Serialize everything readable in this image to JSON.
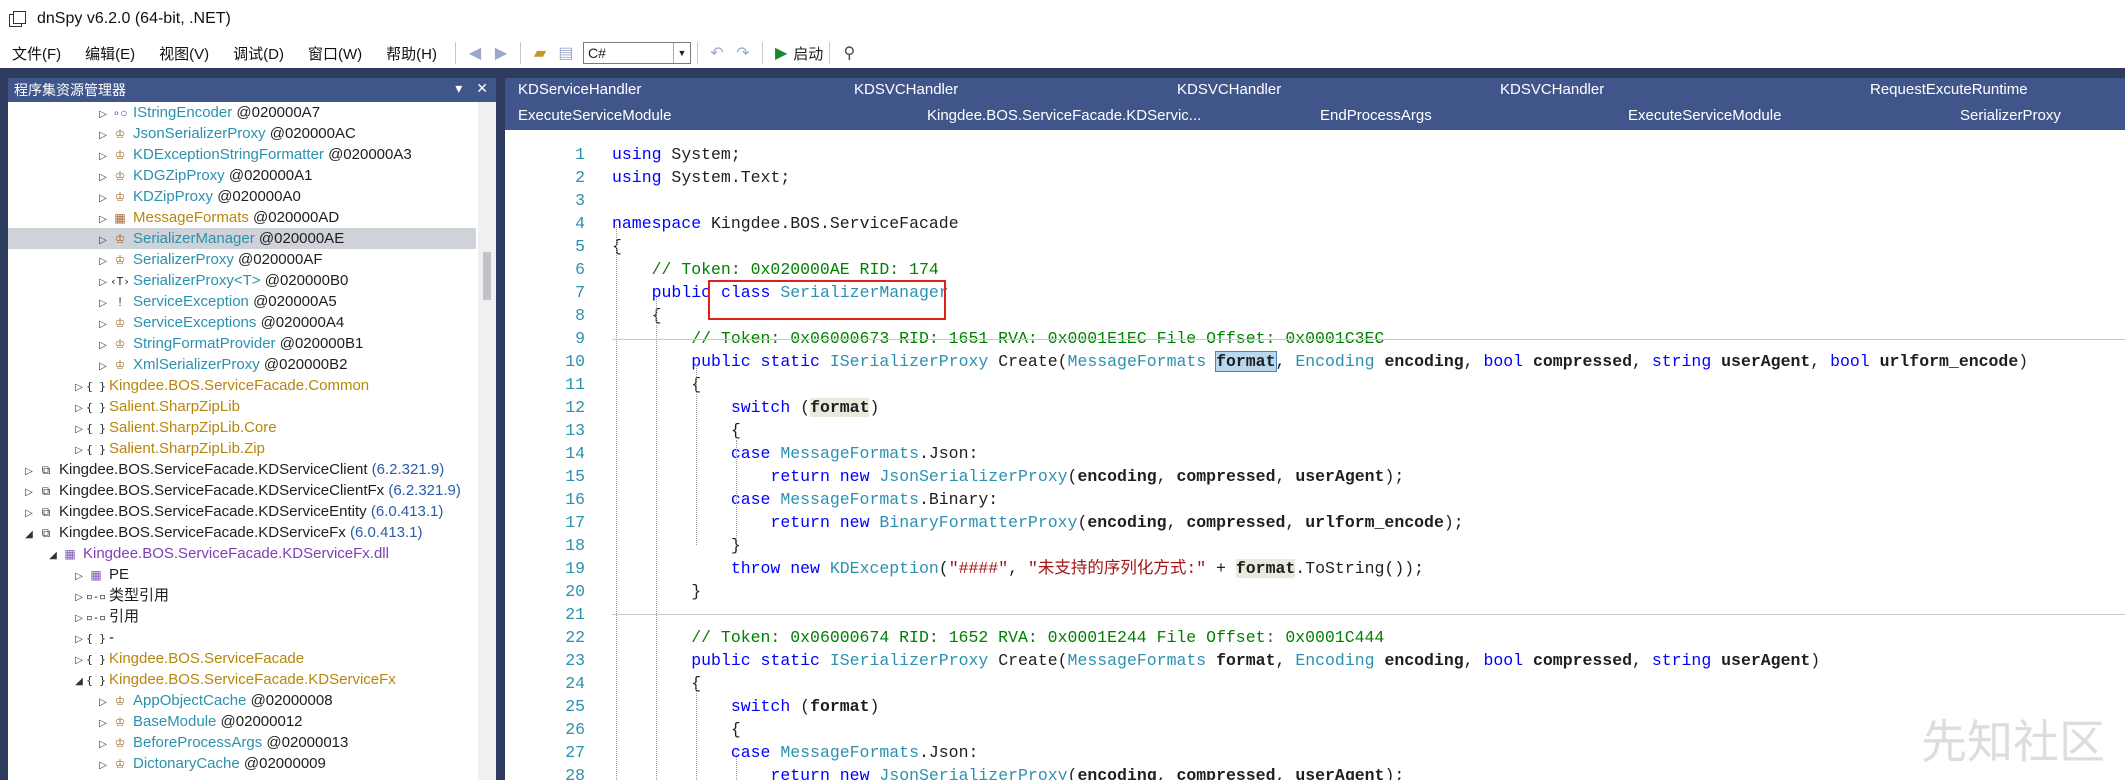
{
  "window": {
    "title": "dnSpy v6.2.0 (64-bit, .NET)"
  },
  "menu": [
    "文件(F)",
    "编辑(E)",
    "视图(V)",
    "调试(D)",
    "窗口(W)",
    "帮助(H)"
  ],
  "toolbar": {
    "language": "C#",
    "run_label": "启动"
  },
  "explorer": {
    "title": "程序集资源管理器",
    "rows": [
      {
        "indent": 88,
        "arrow": "▷",
        "icon": "∘○",
        "iconClass": "iface",
        "name": "IStringEncoder",
        "token": " @020000A7",
        "nameClass": "c-type"
      },
      {
        "indent": 88,
        "arrow": "▷",
        "icon": "♔",
        "iconClass": "cls",
        "name": "JsonSerializerProxy",
        "token": " @020000AC",
        "nameClass": "c-type"
      },
      {
        "indent": 88,
        "arrow": "▷",
        "icon": "♔",
        "iconClass": "cls",
        "name": "KDExceptionStringFormatter",
        "token": " @020000A3",
        "nameClass": "c-type"
      },
      {
        "indent": 88,
        "arrow": "▷",
        "icon": "♔",
        "iconClass": "cls",
        "name": "KDGZipProxy",
        "token": " @020000A1",
        "nameClass": "c-type"
      },
      {
        "indent": 88,
        "arrow": "▷",
        "icon": "♔",
        "iconClass": "cls",
        "name": "KDZipProxy",
        "token": " @020000A0",
        "nameClass": "c-type"
      },
      {
        "indent": 88,
        "arrow": "▷",
        "icon": "▦",
        "iconClass": "cls",
        "name": "MessageFormats",
        "token": " @020000AD",
        "nameClass": "c-ns"
      },
      {
        "indent": 88,
        "arrow": "▷",
        "icon": "♔",
        "iconClass": "cls",
        "name": "SerializerManager",
        "token": " @020000AE",
        "nameClass": "c-type",
        "selected": true
      },
      {
        "indent": 88,
        "arrow": "▷",
        "icon": "♔",
        "iconClass": "cls",
        "name": "SerializerProxy",
        "token": " @020000AF",
        "nameClass": "c-type"
      },
      {
        "indent": 88,
        "arrow": "▷",
        "icon": "‹T›",
        "iconClass": "ns",
        "name": "SerializerProxy<T>",
        "token": " @020000B0",
        "nameClass": "c-type"
      },
      {
        "indent": 88,
        "arrow": "▷",
        "icon": "!",
        "iconClass": "asm",
        "name": "ServiceException",
        "token": " @020000A5",
        "nameClass": "c-type"
      },
      {
        "indent": 88,
        "arrow": "▷",
        "icon": "♔",
        "iconClass": "cls",
        "name": "ServiceExceptions",
        "token": " @020000A4",
        "nameClass": "c-type"
      },
      {
        "indent": 88,
        "arrow": "▷",
        "icon": "♔",
        "iconClass": "cls",
        "name": "StringFormatProvider",
        "token": " @020000B1",
        "nameClass": "c-type"
      },
      {
        "indent": 88,
        "arrow": "▷",
        "icon": "♔",
        "iconClass": "cls",
        "name": "XmlSerializerProxy",
        "token": " @020000B2",
        "nameClass": "c-type"
      },
      {
        "indent": 64,
        "arrow": "▷",
        "icon": "{ }",
        "iconClass": "ns",
        "name": "Kingdee.BOS.ServiceFacade.Common",
        "token": "",
        "nameClass": "c-ns"
      },
      {
        "indent": 64,
        "arrow": "▷",
        "icon": "{ }",
        "iconClass": "ns",
        "name": "Salient.SharpZipLib",
        "token": "",
        "nameClass": "c-ns"
      },
      {
        "indent": 64,
        "arrow": "▷",
        "icon": "{ }",
        "iconClass": "ns",
        "name": "Salient.SharpZipLib.Core",
        "token": "",
        "nameClass": "c-ns"
      },
      {
        "indent": 64,
        "arrow": "▷",
        "icon": "{ }",
        "iconClass": "ns",
        "name": "Salient.SharpZipLib.Zip",
        "token": "",
        "nameClass": "c-ns"
      },
      {
        "indent": 14,
        "arrow": "▷",
        "icon": "⧉",
        "iconClass": "asm",
        "name": "Kingdee.BOS.ServiceFacade.KDServiceClient",
        "token": " (6.2.321.9)",
        "nameClass": "c-plain",
        "tokenClass": "c-ver"
      },
      {
        "indent": 14,
        "arrow": "▷",
        "icon": "⧉",
        "iconClass": "asm",
        "name": "Kingdee.BOS.ServiceFacade.KDServiceClientFx",
        "token": " (6.2.321.9)",
        "nameClass": "c-plain",
        "tokenClass": "c-ver"
      },
      {
        "indent": 14,
        "arrow": "▷",
        "icon": "⧉",
        "iconClass": "asm",
        "name": "Kingdee.BOS.ServiceFacade.KDServiceEntity",
        "token": " (6.0.413.1)",
        "nameClass": "c-plain",
        "tokenClass": "c-ver"
      },
      {
        "indent": 14,
        "arrow": "◢",
        "icon": "⧉",
        "iconClass": "asm",
        "name": "Kingdee.BOS.ServiceFacade.KDServiceFx",
        "token": " (6.0.413.1)",
        "nameClass": "c-plain",
        "tokenClass": "c-ver"
      },
      {
        "indent": 38,
        "arrow": "◢",
        "icon": "▦",
        "iconClass": "dll",
        "name": "Kingdee.BOS.ServiceFacade.KDServiceFx.dll",
        "token": "",
        "nameClass": "c-dll"
      },
      {
        "indent": 64,
        "arrow": "▷",
        "icon": "▦",
        "iconClass": "dll",
        "name": "PE",
        "token": "",
        "nameClass": "c-plain"
      },
      {
        "indent": 64,
        "arrow": "▷",
        "icon": "▫-▫",
        "iconClass": "ns",
        "name": "类型引用",
        "token": "",
        "nameClass": "c-plain"
      },
      {
        "indent": 64,
        "arrow": "▷",
        "icon": "▫-▫",
        "iconClass": "ns",
        "name": "引用",
        "token": "",
        "nameClass": "c-plain"
      },
      {
        "indent": 64,
        "arrow": "▷",
        "icon": "{ }",
        "iconClass": "ns",
        "name": "-",
        "token": "",
        "nameClass": "c-plain"
      },
      {
        "indent": 64,
        "arrow": "▷",
        "icon": "{ }",
        "iconClass": "ns",
        "name": "Kingdee.BOS.ServiceFacade",
        "token": "",
        "nameClass": "c-ns"
      },
      {
        "indent": 64,
        "arrow": "◢",
        "icon": "{ }",
        "iconClass": "ns",
        "name": "Kingdee.BOS.ServiceFacade.KDServiceFx",
        "token": "",
        "nameClass": "c-ns"
      },
      {
        "indent": 88,
        "arrow": "▷",
        "icon": "♔",
        "iconClass": "cls",
        "name": "AppObjectCache",
        "token": " @02000008",
        "nameClass": "c-type"
      },
      {
        "indent": 88,
        "arrow": "▷",
        "icon": "♔",
        "iconClass": "cls",
        "name": "BaseModule",
        "token": " @02000012",
        "nameClass": "c-type"
      },
      {
        "indent": 88,
        "arrow": "▷",
        "icon": "♔",
        "iconClass": "cls",
        "name": "BeforeProcessArgs",
        "token": " @02000013",
        "nameClass": "c-type"
      },
      {
        "indent": 88,
        "arrow": "▷",
        "icon": "♔",
        "iconClass": "cls",
        "name": "DictonaryCache",
        "token": " @02000009",
        "nameClass": "c-type"
      }
    ]
  },
  "tabs": {
    "row1": [
      "KDServiceHandler",
      "KDSVCHandler",
      "KDSVCHandler",
      "KDSVCHandler",
      "RequestExcuteRuntime"
    ],
    "row2": [
      "ExecuteServiceModule",
      "Kingdee.BOS.ServiceFacade.KDServic...",
      "EndProcessArgs",
      "ExecuteServiceModule",
      "SerializerProxy"
    ]
  },
  "code_lines": [
    {
      "n": "1",
      "html": "<span class='kw'>using</span> <span class='ns'>System</span>;"
    },
    {
      "n": "2",
      "html": "<span class='kw'>using</span> <span class='ns'>System</span>.<span class='ns'>Text</span>;"
    },
    {
      "n": "3",
      "html": ""
    },
    {
      "n": "4",
      "html": "<span class='kw'>namespace</span> <span class='ns'>Kingdee</span>.<span class='ns'>BOS</span>.<span class='ns'>ServiceFacade</span>"
    },
    {
      "n": "5",
      "html": "{"
    },
    {
      "n": "6",
      "html": "    <span class='cm'>// Token: 0x020000AE RID: 174</span>"
    },
    {
      "n": "7",
      "html": "    <span class='kw'>public</span> <span class='kw'>class</span> <span class='ty'>SerializerManager</span>"
    },
    {
      "n": "8",
      "html": "    {"
    },
    {
      "n": "9",
      "html": "        <span class='cm'>// Token: 0x06000673 RID: 1651 RVA: 0x0001E1EC File Offset: 0x0001C3EC</span>"
    },
    {
      "n": "10",
      "html": "        <span class='kw'>public</span> <span class='kw'>static</span> <span class='ty'>ISerializerProxy</span> <span class='ns'>Create</span>(<span class='ty'>MessageFormats</span> <span class='bold hl'>format</span>, <span class='ty'>Encoding</span> <span class='bold'>encoding</span>, <span class='kw'>bool</span> <span class='bold'>compressed</span>, <span class='kw'>string</span> <span class='bold'>userAgent</span>, <span class='kw'>bool</span> <span class='bold'>urlform_encode</span>)"
    },
    {
      "n": "11",
      "html": "        {"
    },
    {
      "n": "12",
      "html": "            <span class='kw'>switch</span> (<span class='bold hl2'>format</span>)"
    },
    {
      "n": "13",
      "html": "            {"
    },
    {
      "n": "14",
      "html": "            <span class='kw'>case</span> <span class='ty'>MessageFormats</span>.<span class='ns'>Json</span>:"
    },
    {
      "n": "15",
      "html": "                <span class='kw'>return</span> <span class='kw'>new</span> <span class='ty'>JsonSerializerProxy</span>(<span class='bold'>encoding</span>, <span class='bold'>compressed</span>, <span class='bold'>userAgent</span>);"
    },
    {
      "n": "16",
      "html": "            <span class='kw'>case</span> <span class='ty'>MessageFormats</span>.<span class='ns'>Binary</span>:"
    },
    {
      "n": "17",
      "html": "                <span class='kw'>return</span> <span class='kw'>new</span> <span class='ty'>BinaryFormatterProxy</span>(<span class='bold'>encoding</span>, <span class='bold'>compressed</span>, <span class='bold'>urlform_encode</span>);"
    },
    {
      "n": "18",
      "html": "            }"
    },
    {
      "n": "19",
      "html": "            <span class='kw'>throw</span> <span class='kw'>new</span> <span class='ty'>KDException</span>(<span class='st'>\"####\"</span>, <span class='st'>\"未支持的序列化方式:\"</span> + <span class='bold hl2'>format</span>.<span class='ns'>ToString</span>());"
    },
    {
      "n": "20",
      "html": "        }"
    },
    {
      "n": "21",
      "html": ""
    },
    {
      "n": "22",
      "html": "        <span class='cm'>// Token: 0x06000674 RID: 1652 RVA: 0x0001E244 File Offset: 0x0001C444</span>"
    },
    {
      "n": "23",
      "html": "        <span class='kw'>public</span> <span class='kw'>static</span> <span class='ty'>ISerializerProxy</span> <span class='ns'>Create</span>(<span class='ty'>MessageFormats</span> <span class='bold'>format</span>, <span class='ty'>Encoding</span> <span class='bold'>encoding</span>, <span class='kw'>bool</span> <span class='bold'>compressed</span>, <span class='kw'>string</span> <span class='bold'>userAgent</span>)"
    },
    {
      "n": "24",
      "html": "        {"
    },
    {
      "n": "25",
      "html": "            <span class='kw'>switch</span> (<span class='bold'>format</span>)"
    },
    {
      "n": "26",
      "html": "            {"
    },
    {
      "n": "27",
      "html": "            <span class='kw'>case</span> <span class='ty'>MessageFormats</span>.<span class='ns'>Json</span>:"
    },
    {
      "n": "28",
      "html": "                <span class='kw'>return</span> <span class='kw'>new</span> <span class='ty'>JsonSerializerProxy</span>(<span class='bold'>encoding</span>, <span class='bold'>compressed</span>, <span class='bold'>userAgent</span>);"
    }
  ],
  "watermark": "先知社区"
}
